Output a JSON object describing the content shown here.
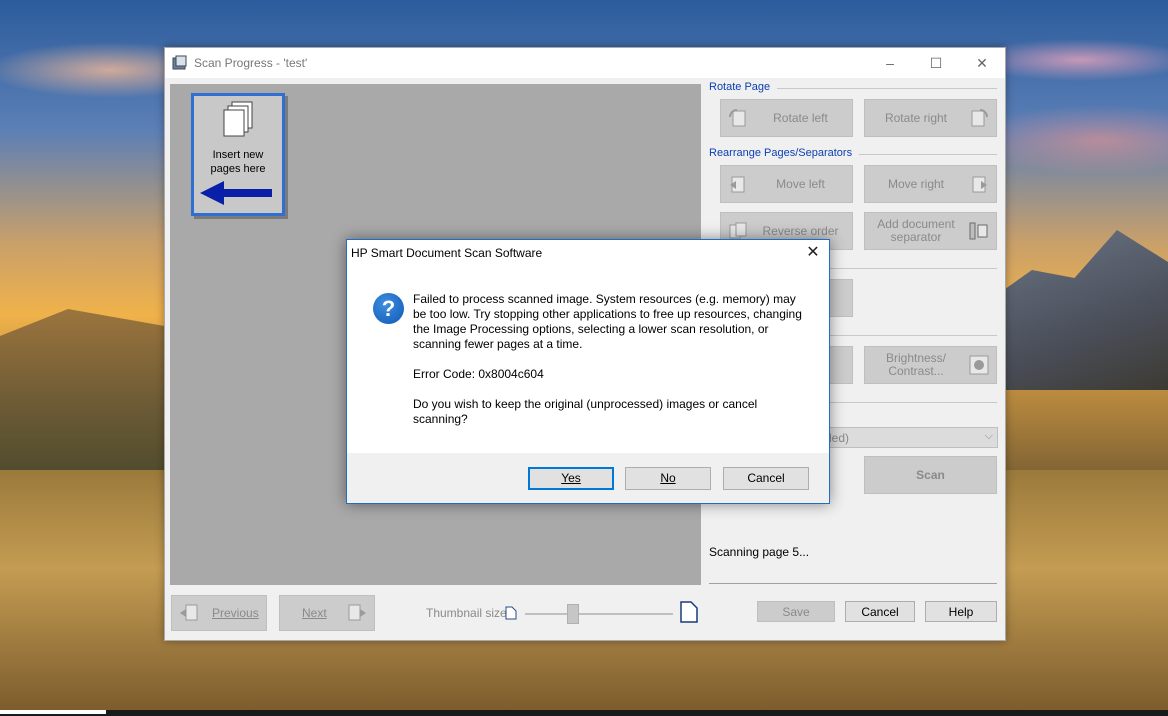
{
  "window": {
    "title": "Scan Progress - 'test'",
    "controls": {
      "minimize": "–",
      "maximize": "☐",
      "close": "✕"
    }
  },
  "thumbnail": {
    "label_line1": "Insert new",
    "label_line2": "pages here"
  },
  "rotate_page": {
    "heading": "Rotate Page",
    "rotate_left": "Rotate left",
    "rotate_right": "Rotate right"
  },
  "rearrange": {
    "heading": "Rearrange Pages/Separators",
    "move_left": "Move left",
    "move_right": "Move right",
    "reverse_order": "Reverse order",
    "add_separator_line1": "Add document",
    "add_separator_line2": "separator"
  },
  "adjust": {
    "brightness_line1": "Brightness/",
    "brightness_line2": "Contrast...",
    "left_partial": ".."
  },
  "dropdown": {
    "value_partial": "led)"
  },
  "scan_button": "Scan",
  "status": "Scanning page 5...",
  "nav": {
    "previous": "Previous",
    "next": "Next",
    "thumbnail_size_label": "Thumbnail size:"
  },
  "bottom_buttons": {
    "save": "Save",
    "cancel": "Cancel",
    "help": "Help"
  },
  "dialog": {
    "title": "HP Smart Document Scan Software",
    "close": "✕",
    "icon": "question-icon",
    "message": "Failed to process scanned image.  System resources (e.g. memory) may be too low.  Try stopping other applications to free up resources, changing the Image Processing options, selecting a lower scan resolution, or scanning fewer pages at a time.",
    "error_code": "Error Code: 0x8004c604",
    "question": "Do you wish to keep the original (unprocessed) images or cancel scanning?",
    "buttons": {
      "yes": "Yes",
      "no": "No",
      "cancel": "Cancel"
    }
  },
  "colors": {
    "accent": "#0078d7",
    "group_label": "#0b3fb4",
    "arrow": "#0a1fa8"
  }
}
